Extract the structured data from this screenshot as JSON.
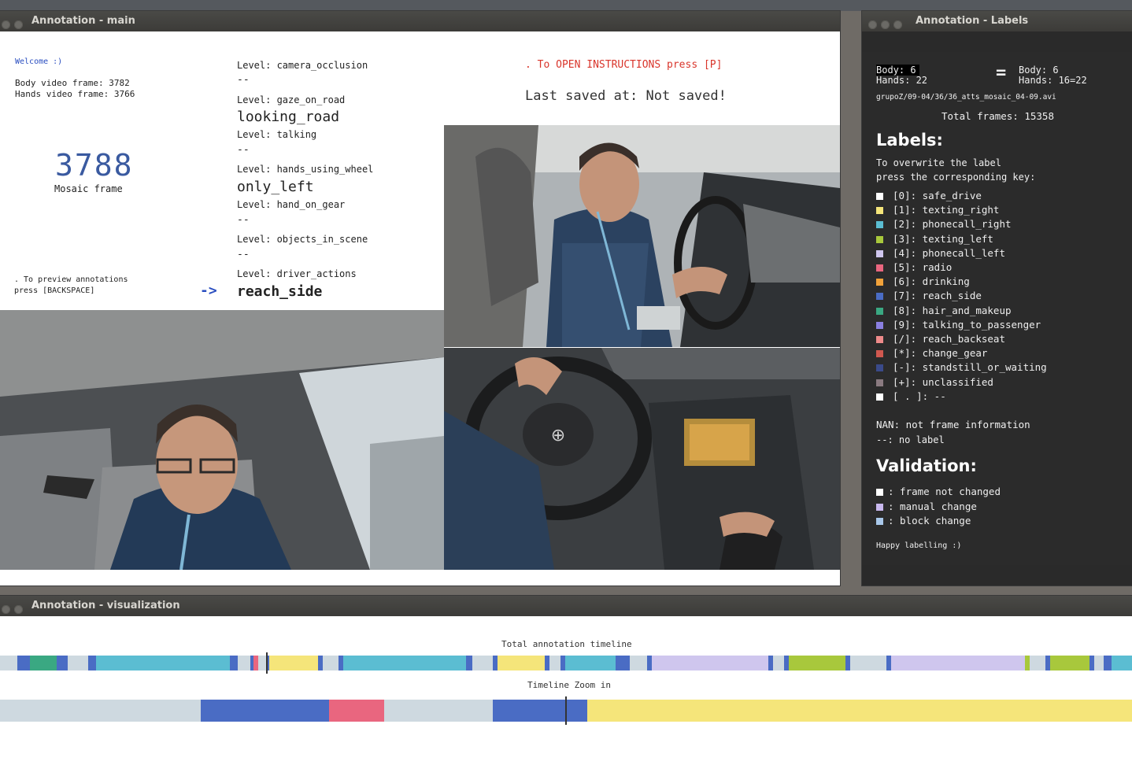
{
  "windows": {
    "main_title": "Annotation - main",
    "labels_title": "Annotation - Labels",
    "viz_title": "Annotation - visualization"
  },
  "main": {
    "welcome": "Welcome :)",
    "body_frame": "Body video frame: 3782",
    "hands_frame": "Hands video frame: 3766",
    "mosaic_frame_number": "3788",
    "mosaic_frame_label": "Mosaic frame",
    "preview_hint_line1": ". To preview annotations",
    "preview_hint_line2": "press [BACKSPACE]",
    "arrow": "->",
    "instructions": ". To OPEN INSTRUCTIONS press [P]",
    "last_saved": "Last saved at: Not saved!",
    "levels": [
      {
        "label": "Level: camera_occlusion",
        "value": "--"
      },
      {
        "label": "Level: gaze_on_road",
        "value": "looking_road"
      },
      {
        "label": "Level: talking",
        "value": "--"
      },
      {
        "label": "Level: hands_using_wheel",
        "value": "only_left"
      },
      {
        "label": "Level: hand_on_gear",
        "value": "--"
      },
      {
        "label": "Level: objects_in_scene",
        "value": "--"
      },
      {
        "label": "Level: driver_actions",
        "value": "reach_side"
      }
    ]
  },
  "labels_panel": {
    "body_left": "Body: 6",
    "hands_left": "Hands: 22",
    "equals": "=",
    "body_right": "Body: 6",
    "hands_right": "Hands: 16=22",
    "file": "grupoZ/09-04/36/36_atts_mosaic_04-09.avi",
    "total_frames": "Total frames: 15358",
    "labels_heading": "Labels:",
    "overwrite_line1": "To overwrite the label",
    "overwrite_line2": "press the corresponding key:",
    "items": [
      {
        "text": "[0]: safe_drive",
        "color": "#ffffff"
      },
      {
        "text": "[1]: texting_right",
        "color": "#f5e57a"
      },
      {
        "text": "[2]: phonecall_right",
        "color": "#5bbdd2"
      },
      {
        "text": "[3]: texting_left",
        "color": "#a8c83c"
      },
      {
        "text": "[4]: phonecall_left",
        "color": "#cfc6ee"
      },
      {
        "text": "[5]: radio",
        "color": "#e9667f"
      },
      {
        "text": "[6]: drinking",
        "color": "#f2a23a"
      },
      {
        "text": "[7]: reach_side",
        "color": "#4a6cc4"
      },
      {
        "text": "[8]: hair_and_makeup",
        "color": "#3aa882"
      },
      {
        "text": "[9]: talking_to_passenger",
        "color": "#8a7fe0"
      },
      {
        "text": "[/]: reach_backseat",
        "color": "#ee8a8a"
      },
      {
        "text": "[*]: change_gear",
        "color": "#d0584f"
      },
      {
        "text": "[-]: standstill_or_waiting",
        "color": "#3a4a8a"
      },
      {
        "text": "[+]: unclassified",
        "color": "#8a7a80"
      },
      {
        "text": "[ . ]: --",
        "color": "#ffffff"
      }
    ],
    "nan_note": "NAN: not frame information",
    "nolabel_note": "--: no label",
    "validation_heading": "Validation:",
    "validation_items": [
      {
        "text": ": frame not changed",
        "color": "#ffffff"
      },
      {
        "text": ": manual change",
        "color": "#c9b8ef"
      },
      {
        "text": ": block change",
        "color": "#a9c8ea"
      }
    ],
    "farewell": "Happy labelling :)"
  },
  "visualization": {
    "total_title": "Total annotation timeline",
    "zoom_title": "Timeline Zoom in",
    "colors": {
      "base": "#ced9e0",
      "blue": "#4a6cc4",
      "teal": "#3aa882",
      "cyan": "#5bbdd2",
      "yellow": "#f5e57a",
      "green": "#a8c83c",
      "lavender": "#cfc6ee",
      "pink": "#e9667f"
    }
  }
}
